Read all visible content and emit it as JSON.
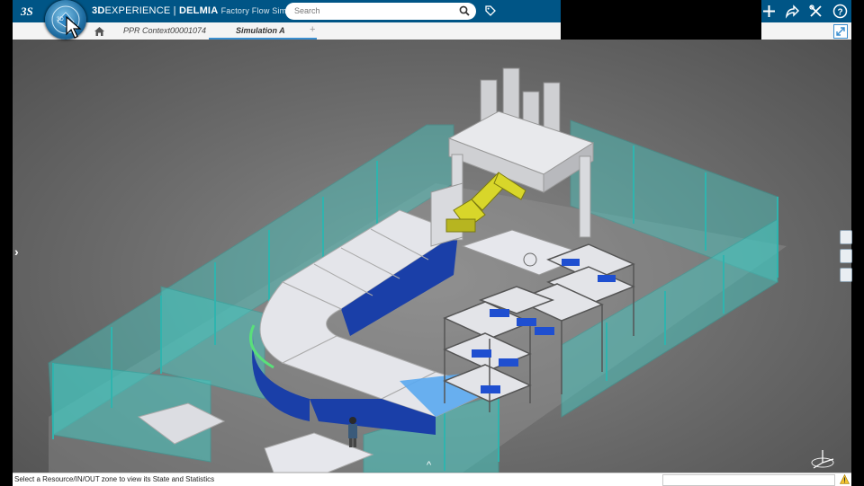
{
  "header": {
    "brand_prefix": "3D",
    "brand_experience": "EXPERIENCE",
    "brand_separator": " | ",
    "brand_product": "DELMIA",
    "app_name": "Factory Flow Simulat...",
    "search_placeholder": "Search"
  },
  "tabs": [
    {
      "label": "PPR Context00001074",
      "active": false
    },
    {
      "label": "Simulation A",
      "active": true
    }
  ],
  "add_tab_label": "+",
  "status": {
    "message": "Select a Resource/IN/OUT zone to view its State and Statistics"
  },
  "colors": {
    "topbar": "#005586",
    "accent": "#3b8fd0",
    "fence": "#46c7c0",
    "conveyor_blue": "#1a3fa8",
    "robot_yellow": "#d8d62a"
  },
  "icons": [
    "3ds-logo",
    "compass",
    "search-icon",
    "tag-icon",
    "plus-icon",
    "share-icon",
    "tools-icon",
    "help-icon",
    "home-icon",
    "expand-icon",
    "chevron-right-icon",
    "chevron-up-icon",
    "navigation-gizmo-icon",
    "warning-icon"
  ]
}
